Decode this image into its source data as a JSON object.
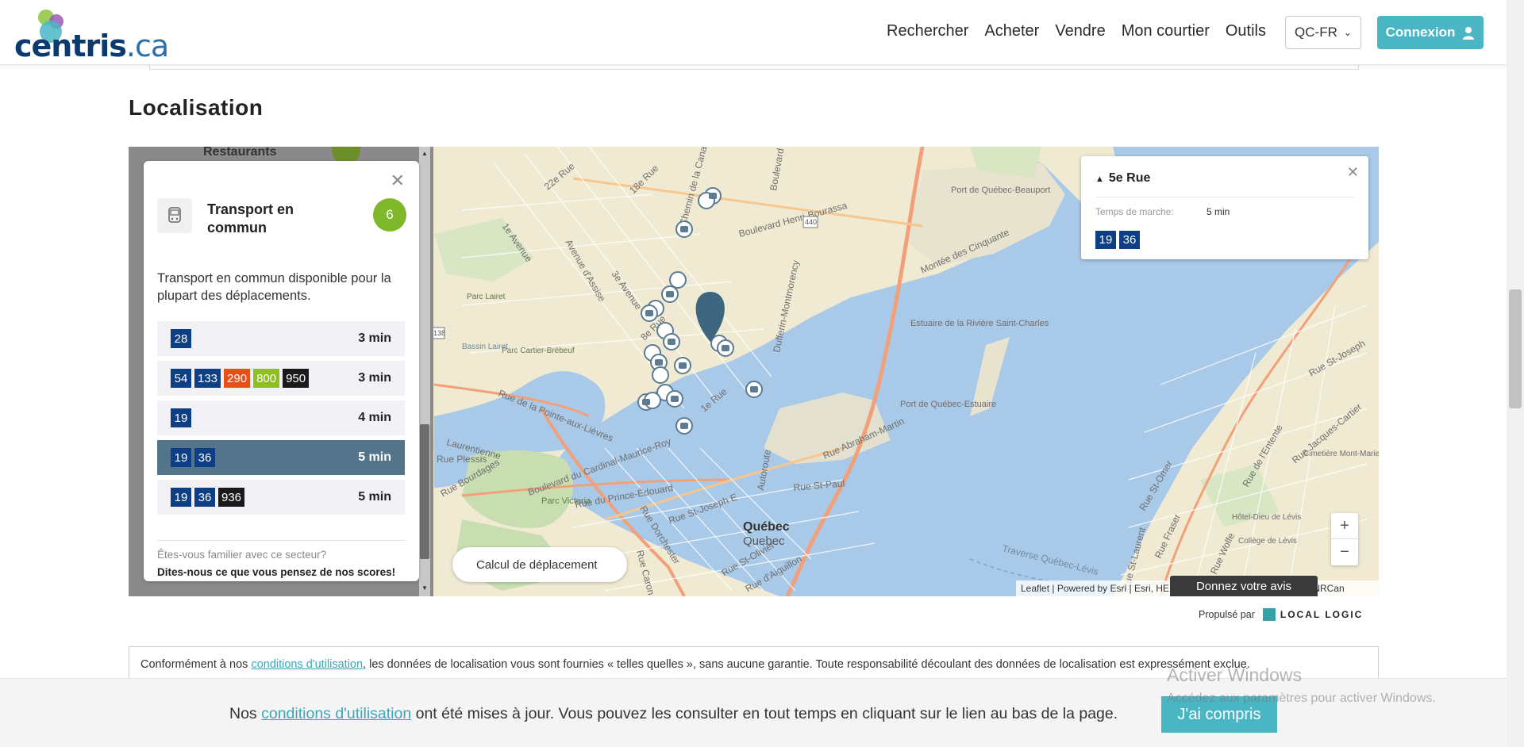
{
  "header": {
    "logo_text": "centris",
    "logo_suffix": ".ca",
    "nav": [
      "Rechercher",
      "Acheter",
      "Vendre",
      "Mon courtier",
      "Outils"
    ],
    "language": "QC-FR",
    "login_label": "Connexion"
  },
  "section": {
    "title": "Localisation"
  },
  "sidebar_ghost": {
    "label": "Restaurants"
  },
  "transit_panel": {
    "title": "Transport en commun",
    "score": "6",
    "description": "Transport en commun disponible pour la plupart des déplacements.",
    "routes": [
      {
        "lines": [
          {
            "n": "28",
            "color": "#0d3f87"
          }
        ],
        "time": "3 min",
        "active": false
      },
      {
        "lines": [
          {
            "n": "54",
            "color": "#0d3f87"
          },
          {
            "n": "133",
            "color": "#0d3f87"
          },
          {
            "n": "290",
            "color": "#e8501a"
          },
          {
            "n": "800",
            "color": "#8ebf1d"
          },
          {
            "n": "950",
            "color": "#1a1a1a"
          }
        ],
        "time": "3 min",
        "active": false
      },
      {
        "lines": [
          {
            "n": "19",
            "color": "#0d3f87"
          }
        ],
        "time": "4 min",
        "active": false
      },
      {
        "lines": [
          {
            "n": "19",
            "color": "#0d3f87"
          },
          {
            "n": "36",
            "color": "#0d3f87"
          }
        ],
        "time": "5 min",
        "active": true
      },
      {
        "lines": [
          {
            "n": "19",
            "color": "#0d3f87"
          },
          {
            "n": "36",
            "color": "#0d3f87"
          },
          {
            "n": "936",
            "color": "#1a1a1a"
          }
        ],
        "time": "5 min",
        "active": false
      }
    ],
    "feedback_question": "Êtes-vous familier avec ce secteur?",
    "feedback_link": "Dites-nous ce que vous pensez de nos scores!"
  },
  "map": {
    "calc_button": "Calcul de déplacement",
    "attribution": "Leaflet | Powered by Esri | Esri, HERE, Garmin, FAO, NOAA, USGS, NRCan",
    "feedback_button": "Donnez votre avis",
    "zoom_in": "+",
    "zoom_out": "−",
    "labels": {
      "quebec": "Québec",
      "quebec2": "Quebec",
      "port_beauport": "Port de Québec-Beauport",
      "estuaire": "Estuaire de la Rivière Saint-Charles",
      "port_estuaire": "Port de Québec-Estuaire",
      "parc_victoria": "Parc Victoria",
      "parc_cartier": "Parc Cartier-Brébeuf",
      "parc_lairet": "Parc Lairet",
      "bassin_lairet": "Bassin Lairet",
      "hotel_dieu": "Hôtel-Dieu de Lévis",
      "college_levis": "Collège de Lévis",
      "cimetiere": "Cimetière Mont-Marie",
      "traverse": "Traverse Québec-Lévis",
      "boul_henri": "Boulevard Henri-Bourassa",
      "montee": "Montée des Cinquante",
      "rue_22e": "22e Rue",
      "rue_18e": "18e Rue",
      "av_1e": "1e Avenue",
      "av_3e": "3e Avenue",
      "rue_1e": "1e Rue",
      "rue_8e": "8e Rue",
      "av_assise": "Avenue d'Assise",
      "rue_pointe": "Rue de la Pointe-aux-Lièvres",
      "boul_cardinal": "Boulevard du Cardinal-Maurice-Roy",
      "rue_prince": "Rue du Prince-Édouard",
      "rue_stpaul": "Rue St-Paul",
      "rue_stjoseph": "Rue St-Joseph E",
      "rue_abraham": "Rue Abraham-Martin",
      "rue_dorchester": "Rue Dorchester",
      "rue_bourdages": "Rue Bourdages",
      "dufferin": "Dufferin-Montmorency",
      "chemin": "Chemin de la Canardière",
      "boulevard": "Boulevard",
      "autoroute": "Autoroute",
      "rue_stomer": "Rue St-Omer",
      "rue_fraser": "Rue Fraser",
      "rue_wolfe": "Rue Wolfe",
      "rue_entente": "Rue de l'Entente",
      "rue_stjoseph_levis": "Rue St-Joseph",
      "rue_jacques": "Rue Jacques-Cartier",
      "rue_stlaurent": "Rue St-Laurent",
      "rue_olivier": "Rue St-Olivier",
      "rue_aiguillon": "Rue d'Aiguillon",
      "laurentienne": "Laurentienne",
      "plessis": "Rue Plessis",
      "rue_caron": "Rue Caron",
      "shield_440": "440",
      "shield_138": "138"
    }
  },
  "popup": {
    "title": "5e Rue",
    "walk_label": "Temps de marche:",
    "walk_value": "5 min",
    "lines": [
      {
        "n": "19",
        "color": "#0d3f87"
      },
      {
        "n": "36",
        "color": "#0d3f87"
      }
    ]
  },
  "powered": {
    "label": "Propulsé par",
    "brand": "LOCAL LOGIC"
  },
  "disclaimer": {
    "before": "Conformément à nos ",
    "link": "conditions d'utilisation",
    "after": ", les données de localisation vous sont fournies « telles quelles », sans aucune garantie. Toute responsabilité découlant des données de localisation est expressément exclue."
  },
  "cookie": {
    "before": "Nos ",
    "link": "conditions d'utilisation",
    "after": " ont été mises à jour. Vous pouvez les consulter en tout temps en cliquant sur le lien au bas de la page.",
    "button": "J'ai compris"
  },
  "watermark": {
    "title": "Activer Windows",
    "subtitle": "Accédez aux paramètres pour activer Windows."
  },
  "colors": {
    "accent": "#4ab6c4",
    "water": "#a9c9e8",
    "land": "#f0ead2",
    "park": "#c9deb0",
    "active_route": "#54748b",
    "score": "#7fb82a"
  }
}
